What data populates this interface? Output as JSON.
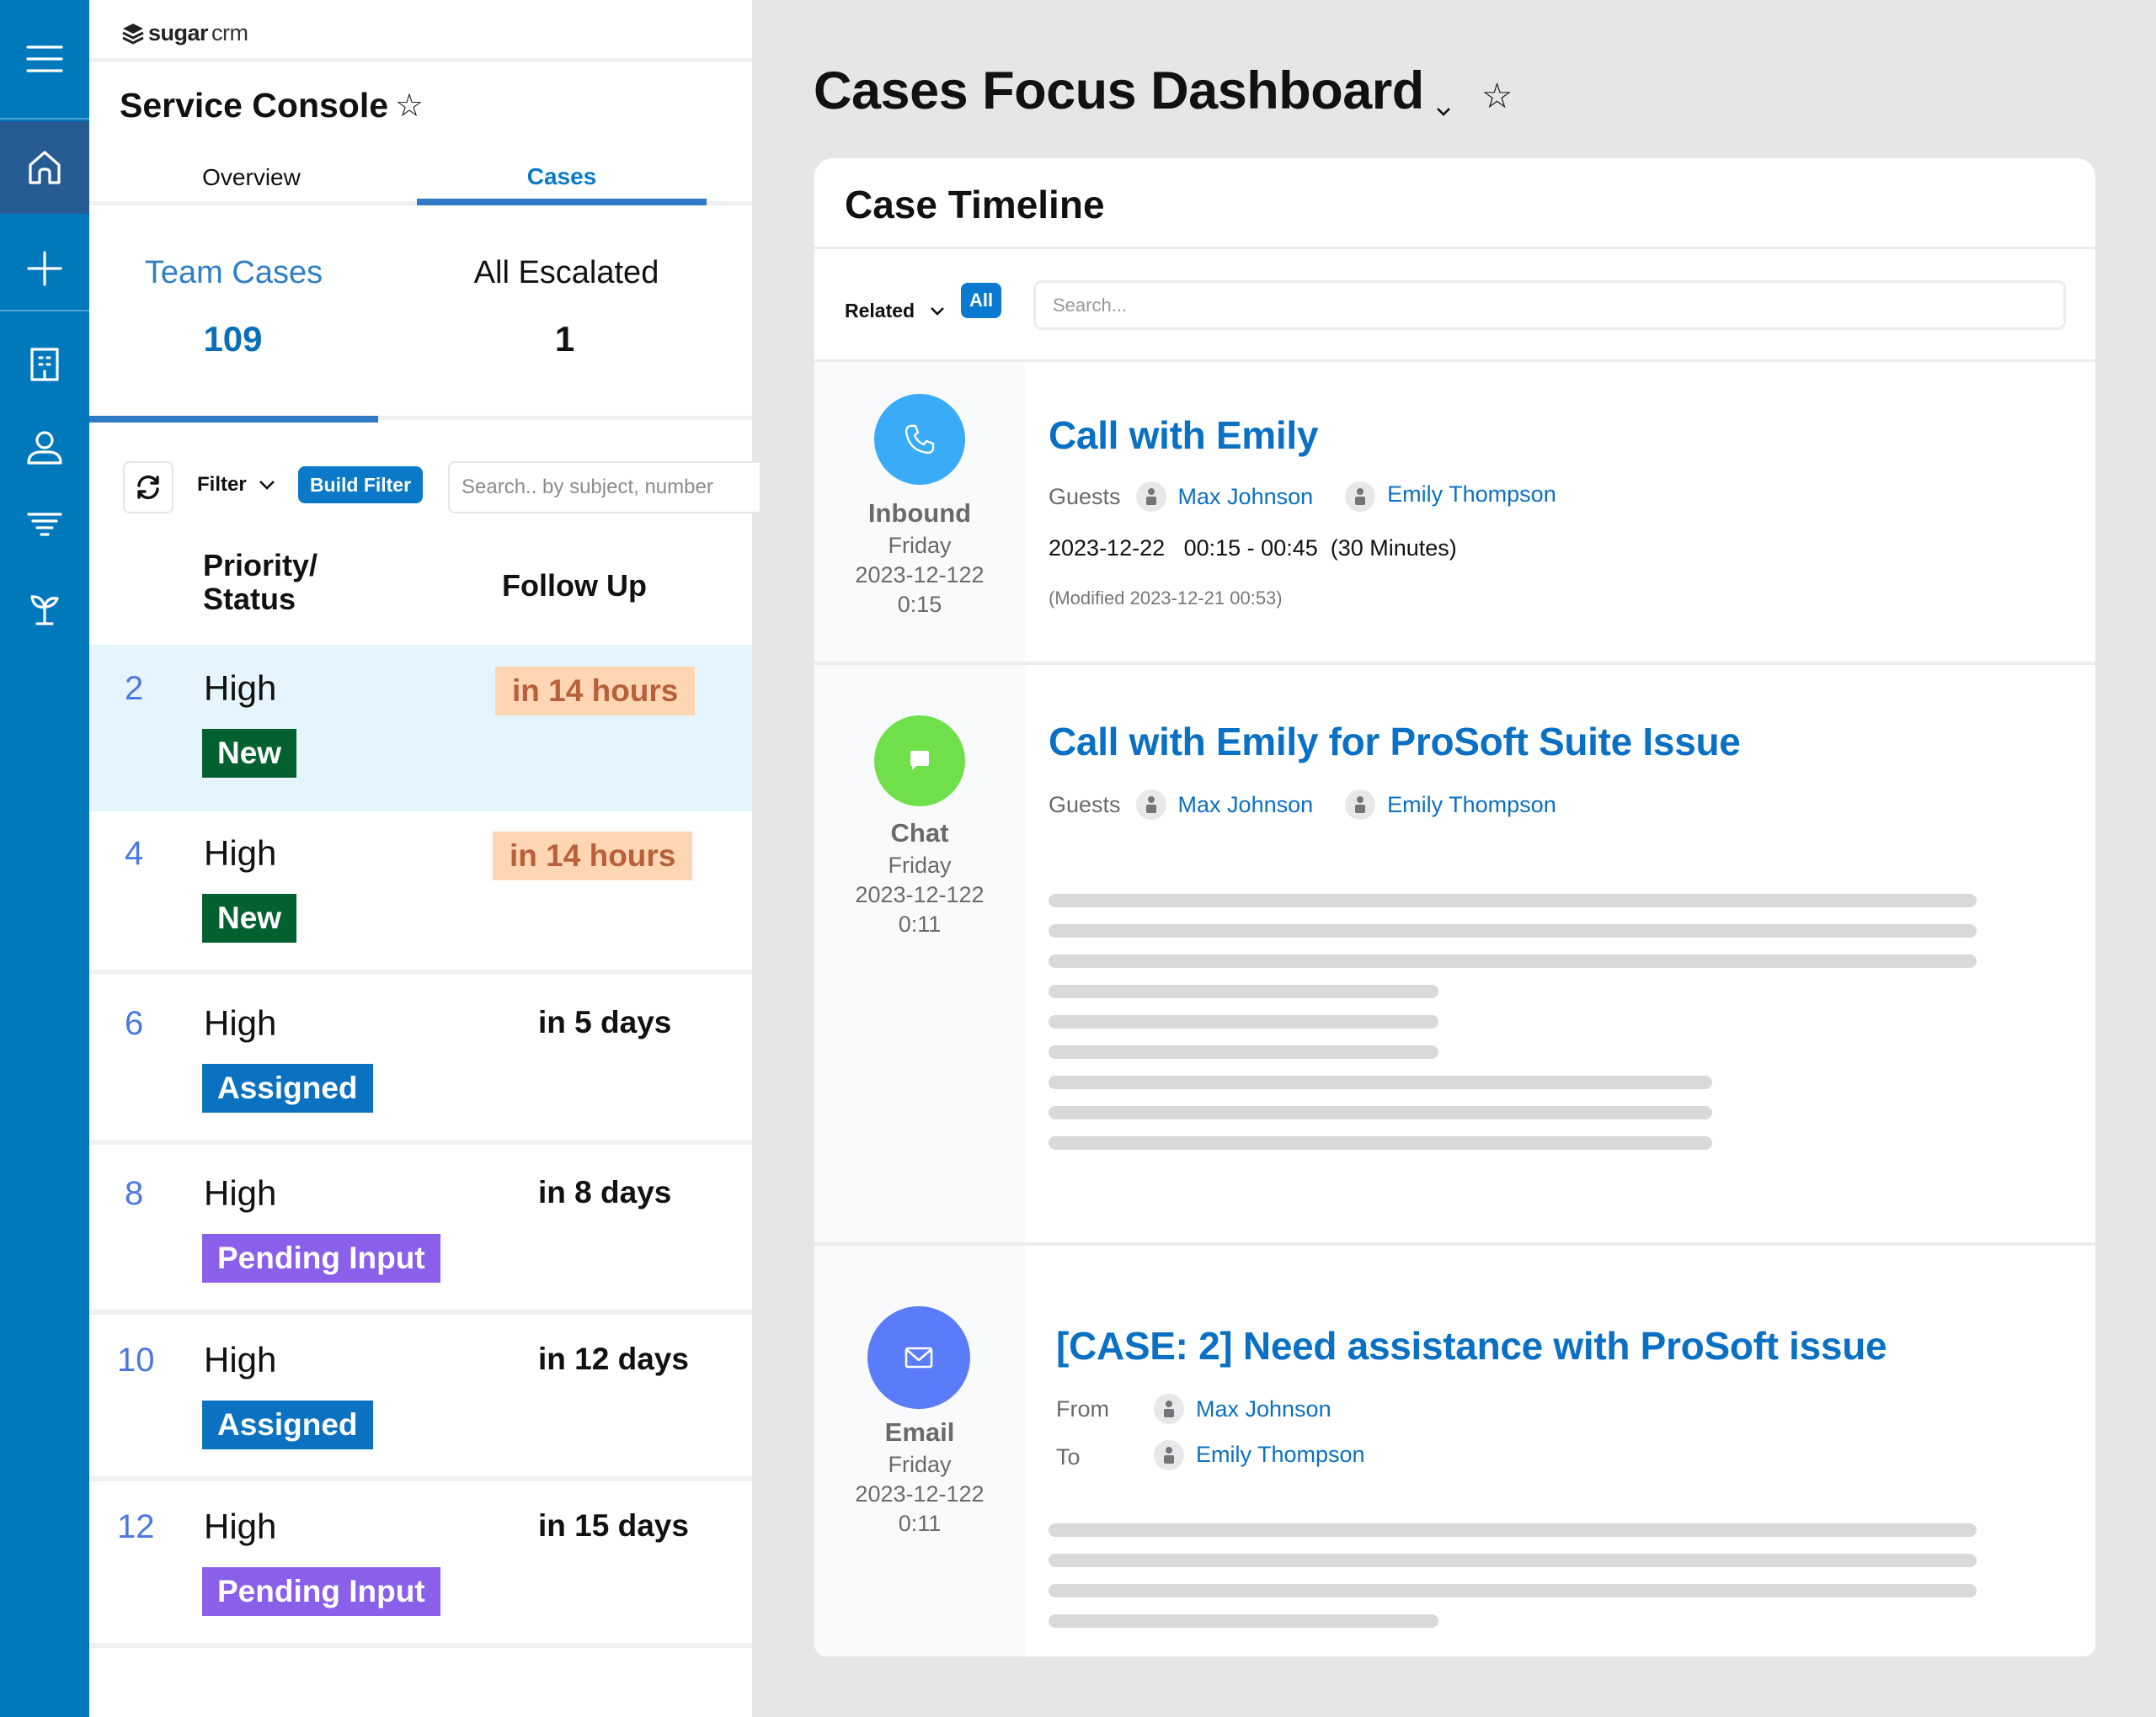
{
  "rail": {
    "items": [
      {
        "name": "menu",
        "icon": "hamburger-menu-icon"
      },
      {
        "name": "home",
        "icon": "home-icon",
        "active": true
      },
      {
        "name": "create",
        "icon": "plus-icon"
      },
      {
        "name": "accounts",
        "icon": "building-icon"
      },
      {
        "name": "contacts",
        "icon": "person-icon"
      },
      {
        "name": "leads",
        "icon": "funnel-icon"
      },
      {
        "name": "opportunities",
        "icon": "sprout-icon"
      }
    ]
  },
  "brand": {
    "sugar": "sugar",
    "crm": "crm"
  },
  "console": {
    "title": "Service Console",
    "star": "☆",
    "tabs": [
      {
        "label": "Overview",
        "active": false
      },
      {
        "label": "Cases",
        "active": true
      }
    ],
    "stats": [
      {
        "label": "Team Cases",
        "count": "109",
        "active": true
      },
      {
        "label": "All Escalated",
        "count": "1",
        "active": false
      }
    ],
    "toolbar": {
      "filter_label": "Filter",
      "build_filter_label": "Build Filter",
      "search_placeholder": "Search.. by subject, number"
    },
    "columns": {
      "priority_status": "Priority/\nStatus",
      "follow_up": "Follow Up"
    },
    "cases": [
      {
        "number": "2",
        "priority": "High",
        "status": "New",
        "status_kind": "new",
        "follow_up": "in 14 hours",
        "follow_soon": true,
        "selected": true
      },
      {
        "number": "4",
        "priority": "High",
        "status": "New",
        "status_kind": "new",
        "follow_up": "in 14 hours",
        "follow_soon": true,
        "selected": false
      },
      {
        "number": "6",
        "priority": "High",
        "status": "Assigned",
        "status_kind": "assigned",
        "follow_up": "in 5 days",
        "follow_soon": false,
        "selected": false
      },
      {
        "number": "8",
        "priority": "High",
        "status": "Pending Input",
        "status_kind": "pending",
        "follow_up": "in 8 days",
        "follow_soon": false,
        "selected": false
      },
      {
        "number": "10",
        "priority": "High",
        "status": "Assigned",
        "status_kind": "assigned",
        "follow_up": "in 12 days",
        "follow_soon": false,
        "selected": false
      },
      {
        "number": "12",
        "priority": "High",
        "status": "Pending Input",
        "status_kind": "pending",
        "follow_up": "in 15 days",
        "follow_soon": false,
        "selected": false
      }
    ]
  },
  "dashboard": {
    "title": "Cases Focus Dashboard",
    "star": "☆",
    "timeline": {
      "title": "Case Timeline",
      "related_label": "Related",
      "all_label": "All",
      "search_placeholder": "Search...",
      "items": [
        {
          "type": "Inbound",
          "icon": "phone-icon",
          "icon_color": "#3aabf8",
          "day": "Friday",
          "date": "2023-12-122",
          "time": "0:15",
          "subject": "Call with Emily",
          "guests_label": "Guests",
          "guests": [
            "Max Johnson",
            "Emily Thompson"
          ],
          "when": "2023-12-22   00:15 - 00:45  (30 Minutes)",
          "modified": "(Modified 2023-12-21 00:53)"
        },
        {
          "type": "Chat",
          "icon": "chat-bubble-icon",
          "icon_color": "#6fe04a",
          "day": "Friday",
          "date": "2023-12-122",
          "time": "0:11",
          "subject": "Call with Emily for ProSoft Suite Issue",
          "guests_label": "Guests",
          "guests": [
            "Max Johnson",
            "Emily Thompson"
          ]
        },
        {
          "type": "Email",
          "icon": "envelope-icon",
          "icon_color": "#5a7cfb",
          "day": "Friday",
          "date": "2023-12-122",
          "time": "0:11",
          "subject": "[CASE: 2] Need assistance with ProSoft issue",
          "from_label": "From",
          "from": "Max Johnson",
          "to_label": "To",
          "to": "Emily Thompson"
        }
      ]
    }
  },
  "colors": {
    "rail": "#0079bc",
    "rail_active": "#275b94",
    "accent": "#0a79c7",
    "status_new": "#03612f",
    "status_assigned": "#0a72c0",
    "status_pending": "#8a60ea",
    "follow_soon_bg": "#fed6b4",
    "follow_soon_text": "#b7603a"
  }
}
